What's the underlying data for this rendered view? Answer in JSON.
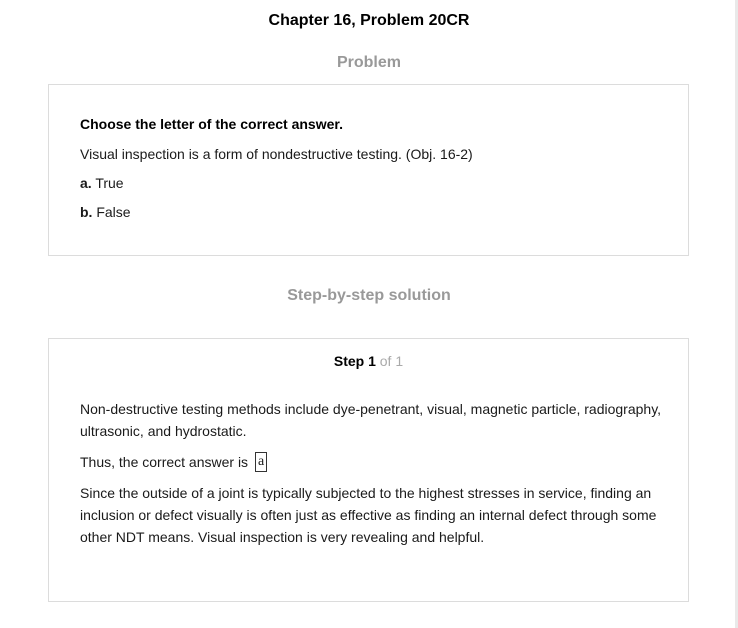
{
  "header": {
    "chapter_title": "Chapter 16, Problem 20CR"
  },
  "problem": {
    "heading": "Problem",
    "instruction": "Choose the letter of the correct answer.",
    "question": "Visual inspection is a form of nondestructive testing. (Obj. 16-2)",
    "options": [
      {
        "letter": "a.",
        "text": "True"
      },
      {
        "letter": "b.",
        "text": "False"
      }
    ]
  },
  "solution": {
    "heading": "Step-by-step solution",
    "step_word": "Step 1",
    "step_of": "of 1",
    "paragraph_1": "Non-destructive testing methods include dye-penetrant, visual, magnetic particle, radiography, ultrasonic, and hydrostatic.",
    "answer_prefix": "Thus, the correct answer is",
    "answer_value": "a",
    "paragraph_3": "Since the outside of a joint is typically subjected to the highest stresses in service, finding an inclusion or defect visually is often just as effective as finding an internal defect through some other NDT means. Visual inspection is very revealing and helpful."
  }
}
